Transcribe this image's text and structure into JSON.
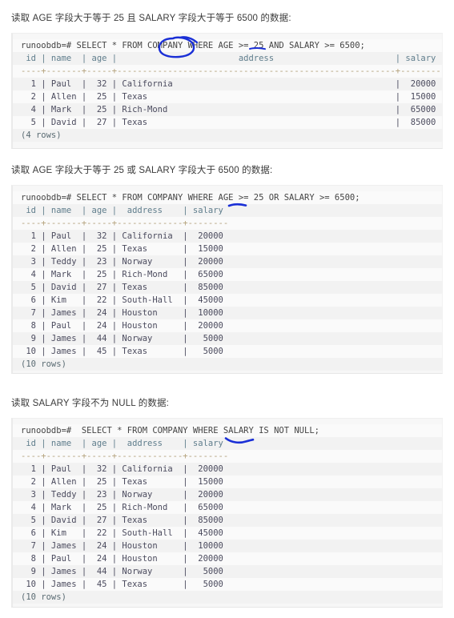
{
  "page": {
    "background": "#ffffff",
    "code_bg": "#f7f7f7",
    "ink_color": "#1a2fd6"
  },
  "sections": [
    {
      "heading": "读取 AGE 字段大于等于 25 且 SALARY 字段大于等于 6500 的数据:",
      "command": "runoobdb=# SELECT * FROM COMPANY WHERE AGE >= 25 AND SALARY >= 6500;",
      "header": " id | name  | age |                        address                        | salary",
      "separator": "----+-------+-----+-------------------------------------------------------+--------",
      "rows": [
        "  1 | Paul  |  32 | California                                            |  20000",
        "  2 | Allen |  25 | Texas                                                 |  15000",
        "  4 | Mark  |  25 | Rich-Mond                                             |  65000",
        "  5 | David |  27 | Texas                                                 |  85000"
      ],
      "footer": "(4 rows)",
      "table_data": {
        "columns": [
          "id",
          "name",
          "age",
          "address",
          "salary"
        ],
        "values": [
          [
            1,
            "Paul",
            32,
            "California",
            20000
          ],
          [
            2,
            "Allen",
            25,
            "Texas",
            15000
          ],
          [
            4,
            "Mark",
            25,
            "Rich-Mond",
            65000
          ],
          [
            5,
            "David",
            27,
            "Texas",
            85000
          ]
        ],
        "row_count": 4
      },
      "annotations": [
        {
          "type": "circle",
          "target": "WHERE"
        },
        {
          "type": "underline",
          "target": "AND"
        }
      ]
    },
    {
      "heading": "读取 AGE 字段大于等于 25 或 SALARY 字段大于 6500 的数据:",
      "command": "runoobdb=# SELECT * FROM COMPANY WHERE AGE >= 25 OR SALARY >= 6500;",
      "header": " id | name  | age |  address    | salary",
      "separator": "----+-------+-----+-------------+--------",
      "rows": [
        "  1 | Paul  |  32 | California  |  20000",
        "  2 | Allen |  25 | Texas       |  15000",
        "  3 | Teddy |  23 | Norway      |  20000",
        "  4 | Mark  |  25 | Rich-Mond   |  65000",
        "  5 | David |  27 | Texas       |  85000",
        "  6 | Kim   |  22 | South-Hall  |  45000",
        "  7 | James |  24 | Houston     |  10000",
        "  8 | Paul  |  24 | Houston     |  20000",
        "  9 | James |  44 | Norway      |   5000",
        " 10 | James |  45 | Texas       |   5000"
      ],
      "footer": "(10 rows)",
      "table_data": {
        "columns": [
          "id",
          "name",
          "age",
          "address",
          "salary"
        ],
        "values": [
          [
            1,
            "Paul",
            32,
            "California",
            20000
          ],
          [
            2,
            "Allen",
            25,
            "Texas",
            15000
          ],
          [
            3,
            "Teddy",
            23,
            "Norway",
            20000
          ],
          [
            4,
            "Mark",
            25,
            "Rich-Mond",
            65000
          ],
          [
            5,
            "David",
            27,
            "Texas",
            85000
          ],
          [
            6,
            "Kim",
            22,
            "South-Hall",
            45000
          ],
          [
            7,
            "James",
            24,
            "Houston",
            10000
          ],
          [
            8,
            "Paul",
            24,
            "Houston",
            20000
          ],
          [
            9,
            "James",
            44,
            "Norway",
            5000
          ],
          [
            10,
            "James",
            45,
            "Texas",
            5000
          ]
        ],
        "row_count": 10
      },
      "annotations": [
        {
          "type": "underline",
          "target": "OR"
        }
      ]
    },
    {
      "heading": "读取 SALARY 字段不为 NULL 的数据:",
      "command": "runoobdb=#  SELECT * FROM COMPANY WHERE SALARY IS NOT NULL;",
      "header": " id | name  | age |  address    | salary",
      "separator": "----+-------+-----+-------------+--------",
      "rows": [
        "  1 | Paul  |  32 | California  |  20000",
        "  2 | Allen |  25 | Texas       |  15000",
        "  3 | Teddy |  23 | Norway      |  20000",
        "  4 | Mark  |  25 | Rich-Mond   |  65000",
        "  5 | David |  27 | Texas       |  85000",
        "  6 | Kim   |  22 | South-Hall  |  45000",
        "  7 | James |  24 | Houston     |  10000",
        "  8 | Paul  |  24 | Houston     |  20000",
        "  9 | James |  44 | Norway      |   5000",
        " 10 | James |  45 | Texas       |   5000"
      ],
      "footer": "(10 rows)",
      "table_data": {
        "columns": [
          "id",
          "name",
          "age",
          "address",
          "salary"
        ],
        "values": [
          [
            1,
            "Paul",
            32,
            "California",
            20000
          ],
          [
            2,
            "Allen",
            25,
            "Texas",
            15000
          ],
          [
            3,
            "Teddy",
            23,
            "Norway",
            20000
          ],
          [
            4,
            "Mark",
            25,
            "Rich-Mond",
            65000
          ],
          [
            5,
            "David",
            27,
            "Texas",
            85000
          ],
          [
            6,
            "Kim",
            22,
            "South-Hall",
            45000
          ],
          [
            7,
            "James",
            24,
            "Houston",
            10000
          ],
          [
            8,
            "Paul",
            24,
            "Houston",
            20000
          ],
          [
            9,
            "James",
            44,
            "Norway",
            5000
          ],
          [
            10,
            "James",
            45,
            "Texas",
            5000
          ]
        ],
        "row_count": 10
      },
      "annotations": [
        {
          "type": "underline-curve",
          "target": "IS NOT"
        }
      ]
    }
  ]
}
